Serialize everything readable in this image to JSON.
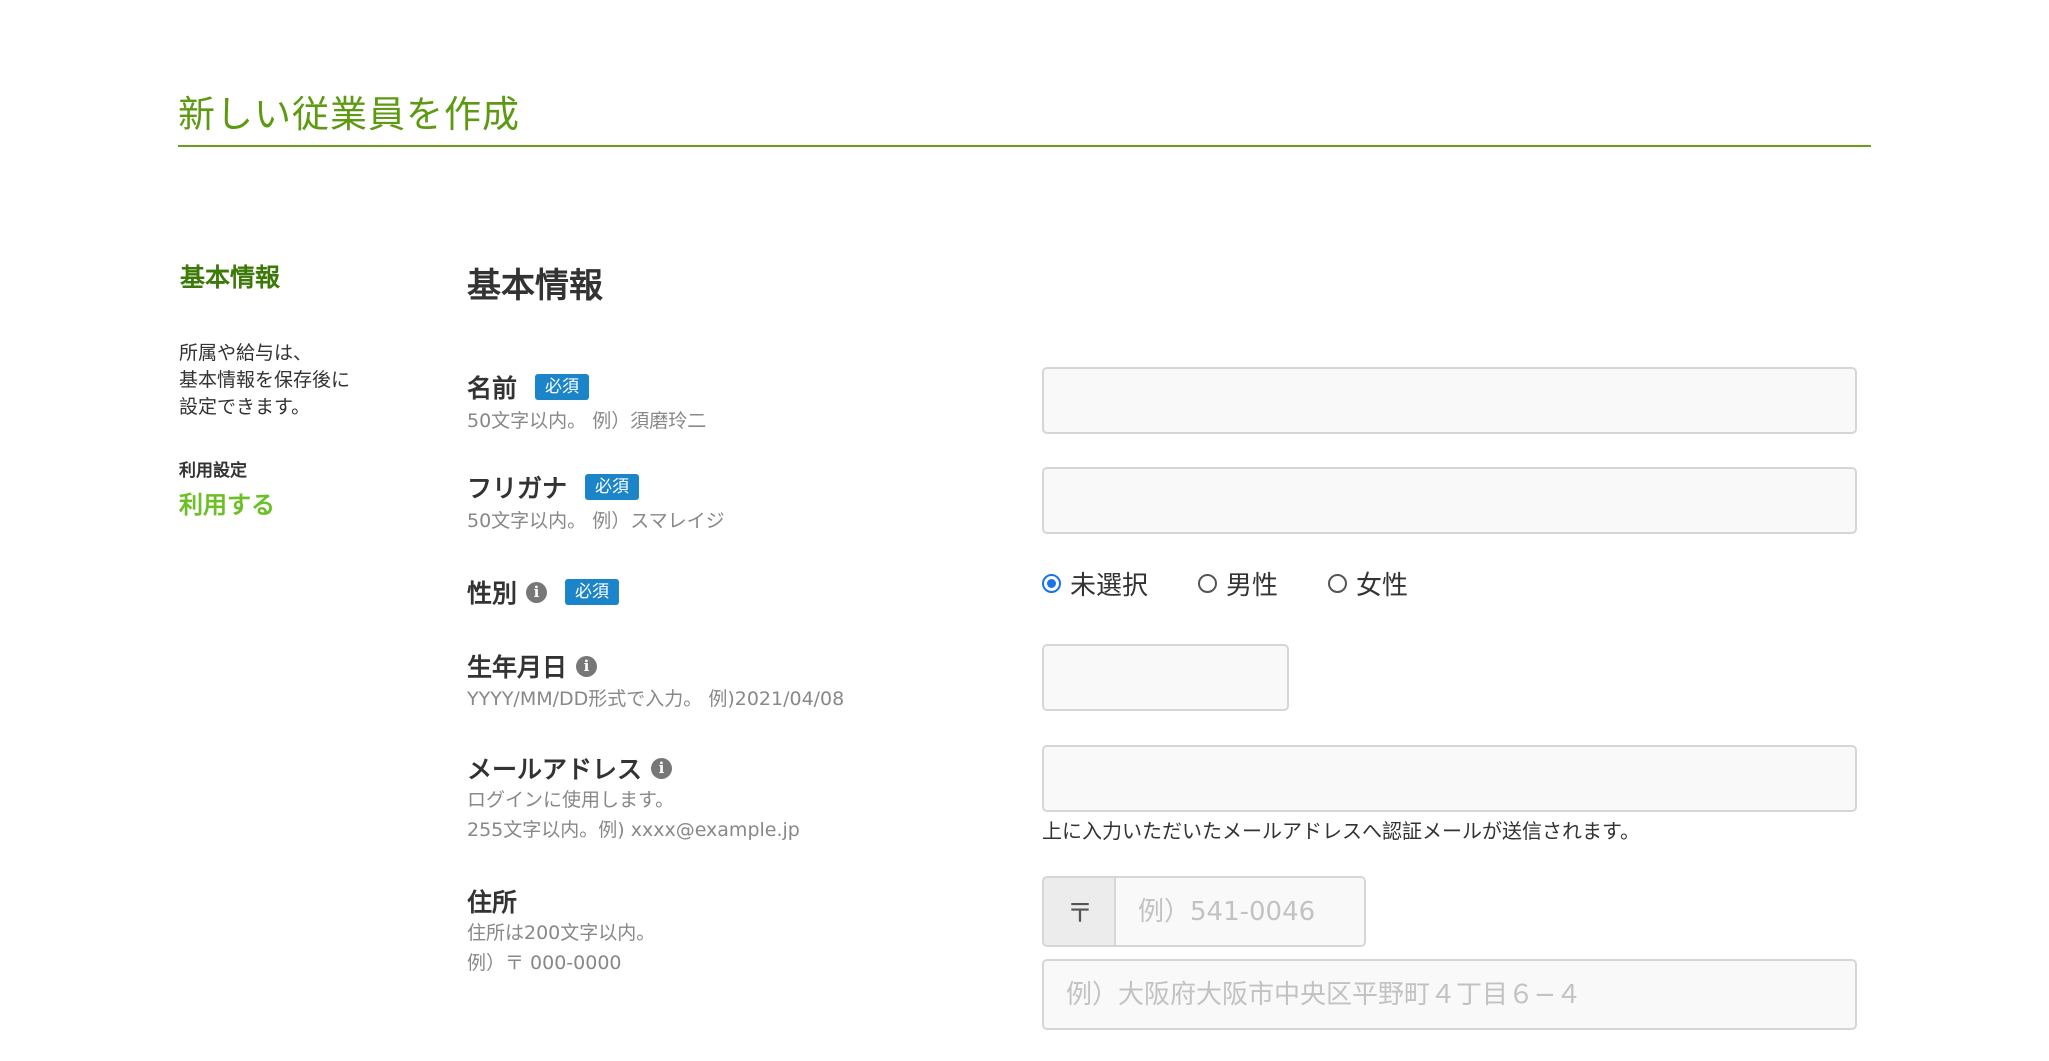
{
  "page": {
    "title": "新しい従業員を作成"
  },
  "sidebar": {
    "heading": "基本情報",
    "note_lines": [
      "所属や給与は、",
      "基本情報を保存後に",
      "設定できます。"
    ],
    "usage_label": "利用設定",
    "usage_value": "利用する"
  },
  "section": {
    "title": "基本情報"
  },
  "form": {
    "required_badge": "必須",
    "name": {
      "label": "名前",
      "hint": "50文字以内。 例）須磨玲二",
      "value": ""
    },
    "kana": {
      "label": "フリガナ",
      "hint": "50文字以内。 例）スマレイジ",
      "value": ""
    },
    "gender": {
      "label": "性別",
      "options": [
        "未選択",
        "男性",
        "女性"
      ],
      "selected": "未選択"
    },
    "birthday": {
      "label": "生年月日",
      "hint": "YYYY/MM/DD形式で入力。 例)2021/04/08",
      "value": ""
    },
    "email": {
      "label": "メールアドレス",
      "hint_lines": [
        "ログインに使用します。",
        "255文字以内。例) xxxx@example.jp"
      ],
      "note": "上に入力いただいたメールアドレスへ認証メールが送信されます。",
      "value": ""
    },
    "address": {
      "label": "住所",
      "hint_lines": [
        "住所は200文字以内。",
        "例）〒 000-0000"
      ],
      "zip_prefix": "〒",
      "zip_placeholder": "例）541-0046",
      "address_placeholder": "例）大阪府大阪市中央区平野町４丁目６−４"
    }
  },
  "icons": {
    "info": "info-icon"
  },
  "colors": {
    "accent": "#5d9a12",
    "badge": "#1c84c8",
    "usage": "#6cc026"
  }
}
